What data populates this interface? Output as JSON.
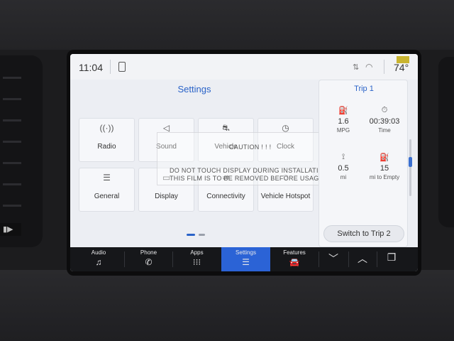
{
  "status": {
    "time": "11:04",
    "temperature": "74°"
  },
  "header": {
    "title": "Settings"
  },
  "tiles": [
    {
      "label": "Radio",
      "icon": "radio-waves-icon"
    },
    {
      "label": "Sound",
      "icon": "speaker-icon"
    },
    {
      "label": "Vehicle",
      "icon": "vehicle-settings-icon"
    },
    {
      "label": "Clock",
      "icon": "clock-icon"
    },
    {
      "label": "General",
      "icon": "sliders-icon"
    },
    {
      "label": "Display",
      "icon": "display-icon"
    },
    {
      "label": "Connectivity",
      "icon": "connectivity-icon"
    },
    {
      "label": "Vehicle Hotspot",
      "icon": "hotspot-icon"
    }
  ],
  "film": {
    "caution": "CAUTION ! ! !",
    "line1": "DO NOT TOUCH DISPLAY DURING INSTALLATION",
    "line2": "THIS FILM IS TO BE REMOVED BEFORE USAGE"
  },
  "trip": {
    "title": "Trip 1",
    "stats": [
      {
        "value": "1.6",
        "label": "MPG",
        "icon": "fuel-economy-icon"
      },
      {
        "value": "00:39:03",
        "label": "Time",
        "icon": "stopwatch-icon"
      },
      {
        "value": "0.5",
        "label": "mi",
        "icon": "distance-icon"
      },
      {
        "value": "15",
        "label": "mi to Empty",
        "icon": "fuel-pump-icon"
      }
    ],
    "switch_label": "Switch to Trip 2"
  },
  "nav": [
    {
      "label": "Audio",
      "icon": "music-note-icon"
    },
    {
      "label": "Phone",
      "icon": "phone-icon"
    },
    {
      "label": "Apps",
      "icon": "apps-grid-icon"
    },
    {
      "label": "Settings",
      "icon": "sliders-icon",
      "active": true
    },
    {
      "label": "Features",
      "icon": "car-features-icon"
    }
  ],
  "colors": {
    "accent": "#2b63d6",
    "screen_bg": "#eceef3",
    "navbar": "#16171a"
  }
}
